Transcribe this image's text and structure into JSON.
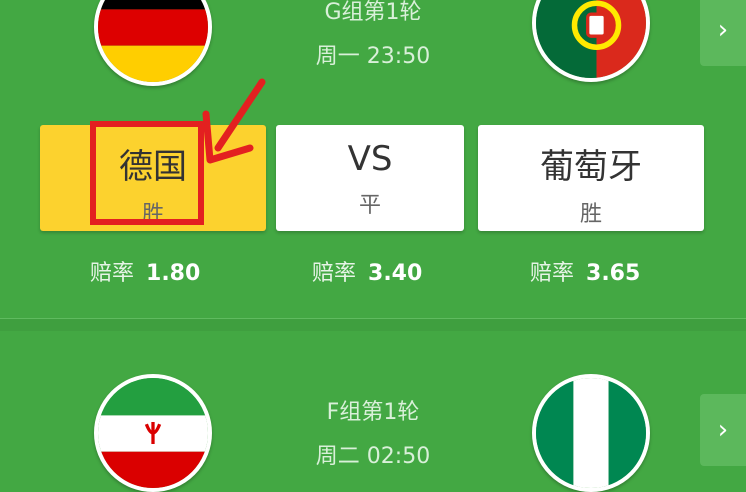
{
  "matches": [
    {
      "group": "G组第1轮",
      "time": "周一 23:50",
      "home_flag": "germany-flag",
      "away_flag": "portugal-flag",
      "options": [
        {
          "team": "德国",
          "result": "胜",
          "odds_label": "赔率",
          "odds": "1.80",
          "selected": true
        },
        {
          "team": "VS",
          "result": "平",
          "odds_label": "赔率",
          "odds": "3.40",
          "selected": false
        },
        {
          "team": "葡萄牙",
          "result": "胜",
          "odds_label": "赔率",
          "odds": "3.65",
          "selected": false
        }
      ],
      "next_icon": "chevron-right-icon"
    },
    {
      "group": "F组第1轮",
      "time": "周二 02:50",
      "home_flag": "iran-flag",
      "away_flag": "nigeria-flag",
      "next_icon": "chevron-right-icon"
    }
  ],
  "colors": {
    "background": "#43a843",
    "selected": "#fcd22e",
    "highlight": "#e32020"
  }
}
